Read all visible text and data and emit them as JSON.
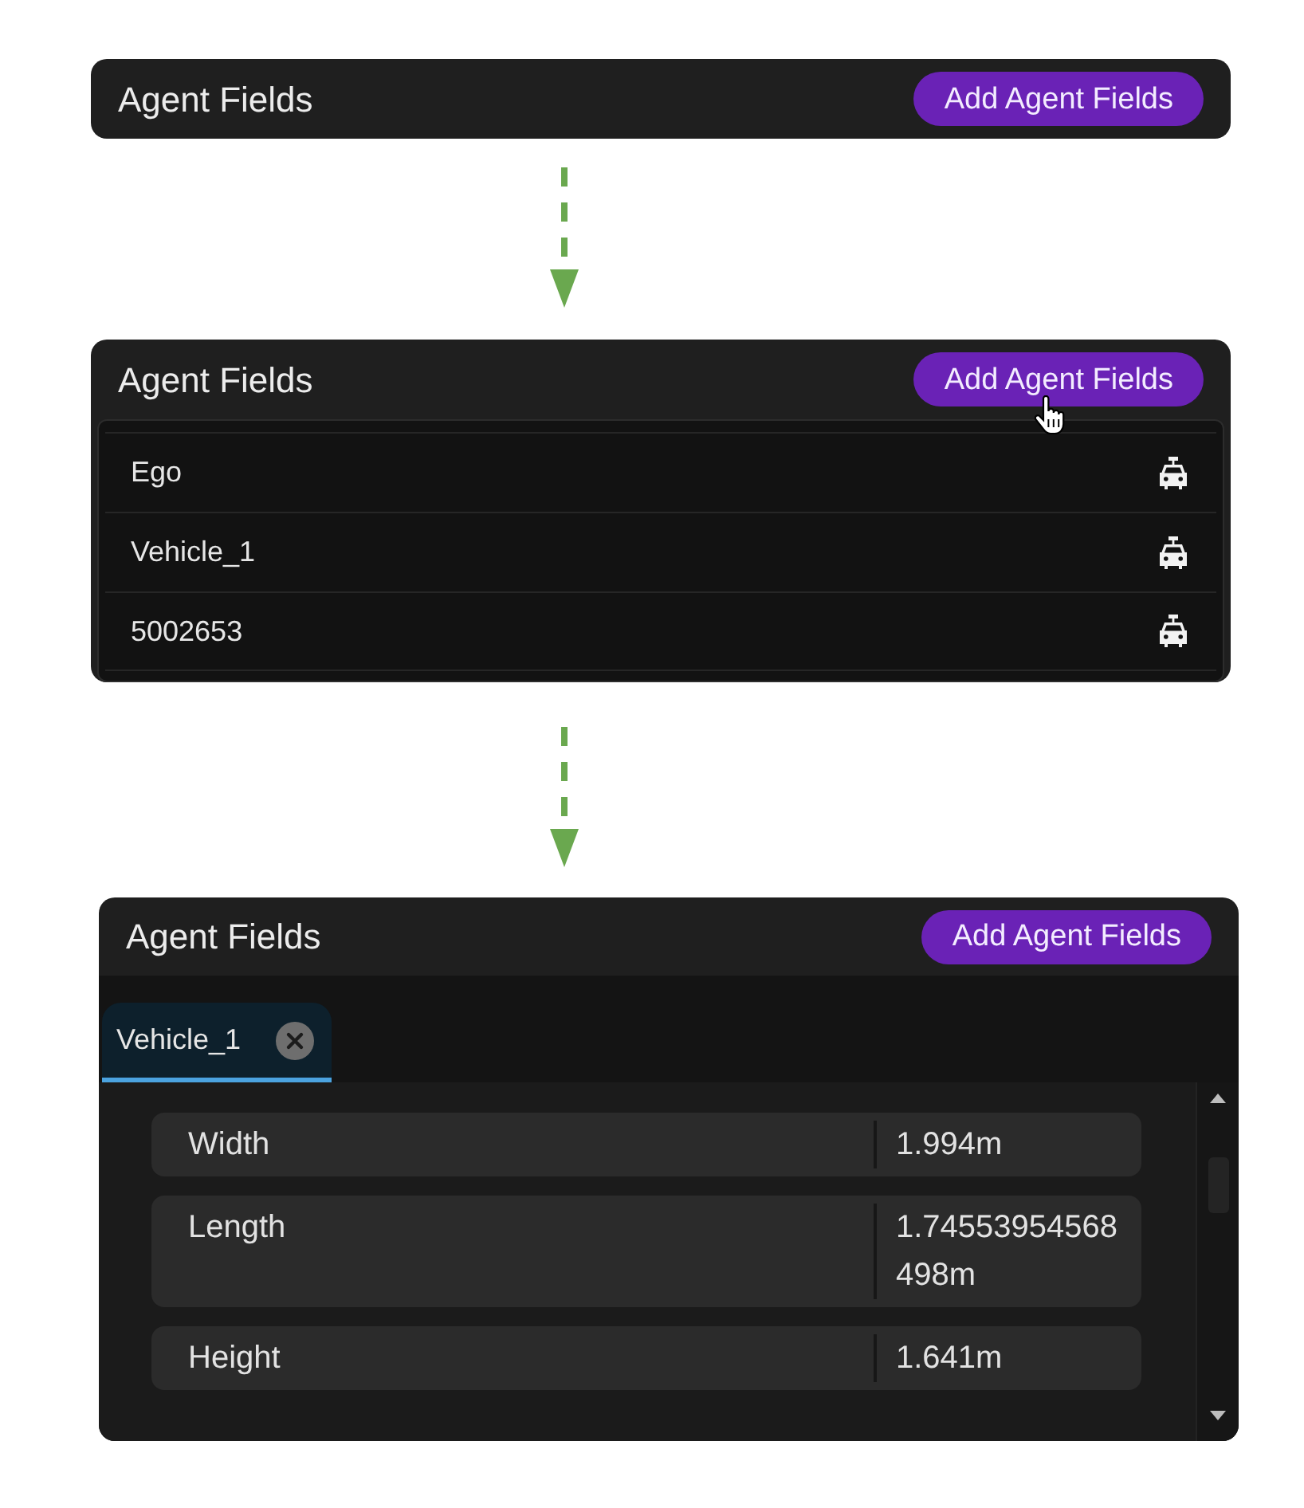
{
  "steps": [
    {
      "kind": "collapsed",
      "title": "Agent Fields",
      "add_button": "Add Agent Fields"
    },
    {
      "kind": "list",
      "title": "Agent Fields",
      "add_button": "Add Agent Fields",
      "agents": [
        {
          "name": "Ego"
        },
        {
          "name": "Vehicle_1"
        },
        {
          "name": "5002653"
        }
      ]
    },
    {
      "kind": "detail",
      "title": "Agent Fields",
      "add_button": "Add Agent Fields",
      "tabs": [
        {
          "label": "Vehicle_1",
          "selected": true
        }
      ],
      "properties": [
        {
          "name": "Width",
          "value": "1.994m"
        },
        {
          "name": "Length",
          "value": "1.74553954568498m"
        },
        {
          "name": "Height",
          "value": "1.641m"
        }
      ]
    }
  ]
}
